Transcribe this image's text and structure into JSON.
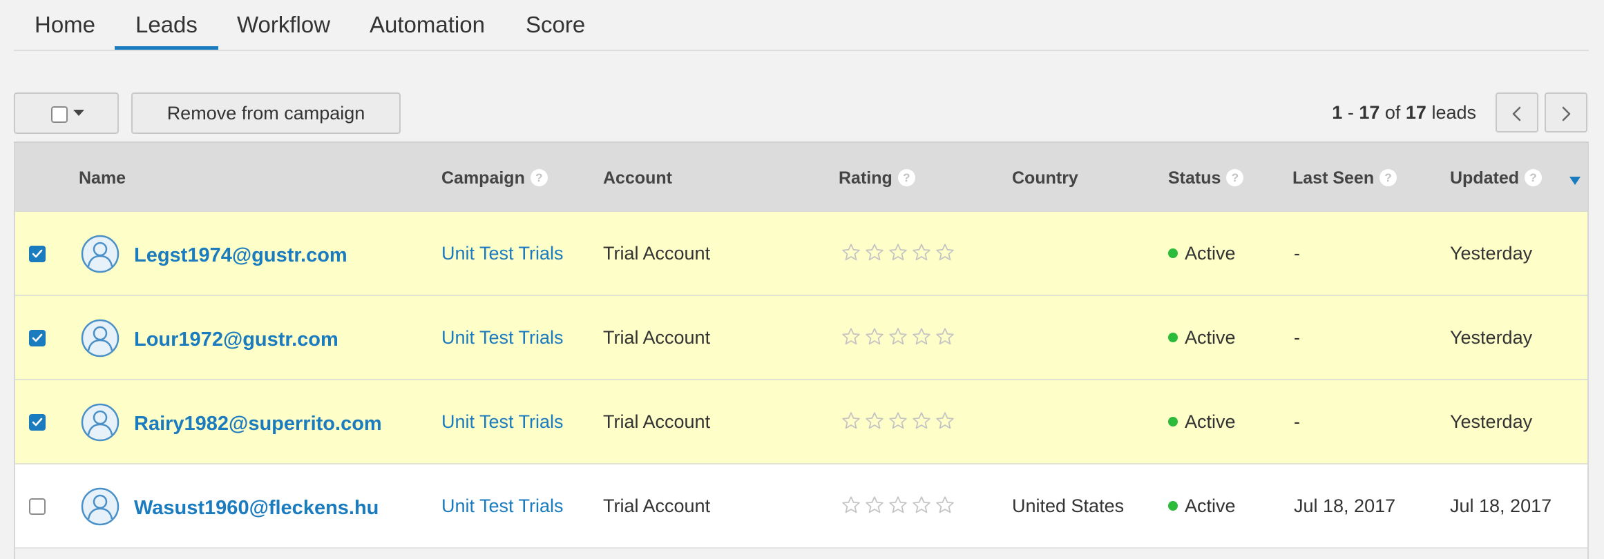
{
  "tabs": [
    {
      "label": "Home",
      "active": false
    },
    {
      "label": "Leads",
      "active": true
    },
    {
      "label": "Workflow",
      "active": false
    },
    {
      "label": "Automation",
      "active": false
    },
    {
      "label": "Score",
      "active": false
    }
  ],
  "toolbar": {
    "remove_label": "Remove from campaign"
  },
  "pager": {
    "start": "1",
    "sep": " - ",
    "end": "17",
    "of": " of ",
    "total": "17",
    "unit": " leads"
  },
  "table": {
    "columns": {
      "name": "Name",
      "campaign": "Campaign",
      "account": "Account",
      "rating": "Rating",
      "country": "Country",
      "status": "Status",
      "last_seen": "Last Seen",
      "updated": "Updated"
    },
    "help_glyph": "?",
    "rows": [
      {
        "checked": true,
        "name": "Legst1974@gustr.com",
        "campaign": "Unit Test Trials",
        "account": "Trial Account",
        "rating": 0,
        "country": "",
        "status": "Active",
        "last_seen": "-",
        "updated": "Yesterday"
      },
      {
        "checked": true,
        "name": "Lour1972@gustr.com",
        "campaign": "Unit Test Trials",
        "account": "Trial Account",
        "rating": 0,
        "country": "",
        "status": "Active",
        "last_seen": "-",
        "updated": "Yesterday"
      },
      {
        "checked": true,
        "name": "Rairy1982@superrito.com",
        "campaign": "Unit Test Trials",
        "account": "Trial Account",
        "rating": 0,
        "country": "",
        "status": "Active",
        "last_seen": "-",
        "updated": "Yesterday"
      },
      {
        "checked": false,
        "name": "Wasust1960@fleckens.hu",
        "campaign": "Unit Test Trials",
        "account": "Trial Account",
        "rating": 0,
        "country": "United States",
        "status": "Active",
        "last_seen": "Jul 18, 2017",
        "updated": "Jul 18, 2017"
      }
    ]
  },
  "colors": {
    "accent": "#1b7bbf",
    "selected_row": "#fefec8",
    "status_active": "#2dbb3c"
  },
  "icons": {
    "select_all": "checkbox-dropdown-icon",
    "prev": "chevron-left-icon",
    "next": "chevron-right-icon",
    "avatar": "user-avatar-icon",
    "star": "star-outline-icon",
    "help": "help-circle-icon",
    "sort": "sort-desc-icon"
  }
}
